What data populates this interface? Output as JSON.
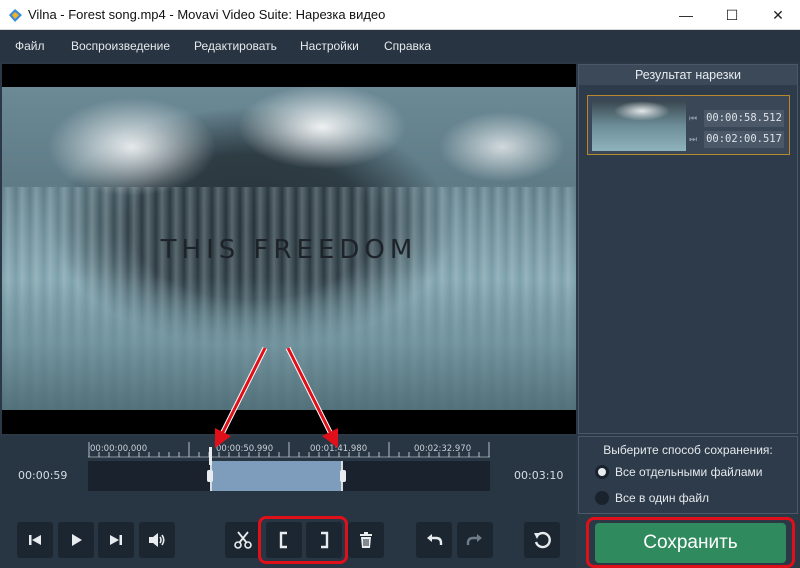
{
  "window": {
    "title": "Vilna - Forest song.mp4 - Movavi Video Suite: Нарезка видео",
    "minimize_glyph": "—",
    "maximize_glyph": "☐",
    "close_glyph": "✕"
  },
  "menu": {
    "items": [
      "Файл",
      "Воспроизведение",
      "Редактировать",
      "Настройки",
      "Справка"
    ]
  },
  "video": {
    "caption": "THIS FREEDOM"
  },
  "result_panel": {
    "title": "Результат нарезки",
    "clip": {
      "start": "00:00:58.512",
      "end": "00:02:00.517"
    }
  },
  "timeline": {
    "current_time": "00:00:59",
    "total_time": "00:03:10",
    "tick_labels": [
      "00:00:00.000",
      "00:00:50.990",
      "00:01:41.980",
      "00:02:32.970"
    ],
    "selection_start_fraction": 0.305,
    "selection_end_fraction": 0.634
  },
  "save_options": {
    "title": "Выберите способ сохранения:",
    "options": [
      {
        "label": "Все отдельными файлами",
        "selected": true
      },
      {
        "label": "Все в один файл",
        "selected": false
      }
    ]
  },
  "toolbar": {
    "icons": [
      "skip-back-icon",
      "play-icon",
      "skip-forward-icon",
      "volume-icon",
      "scissors-icon",
      "mark-in-icon",
      "mark-out-icon",
      "trash-icon",
      "undo-icon",
      "redo-icon",
      "reset-icon"
    ]
  },
  "save_button": {
    "label": "Сохранить"
  },
  "colors": {
    "accent_green": "#2f8a5e",
    "highlight_red": "#e0101a",
    "selection_blue": "#7e9dbd"
  }
}
